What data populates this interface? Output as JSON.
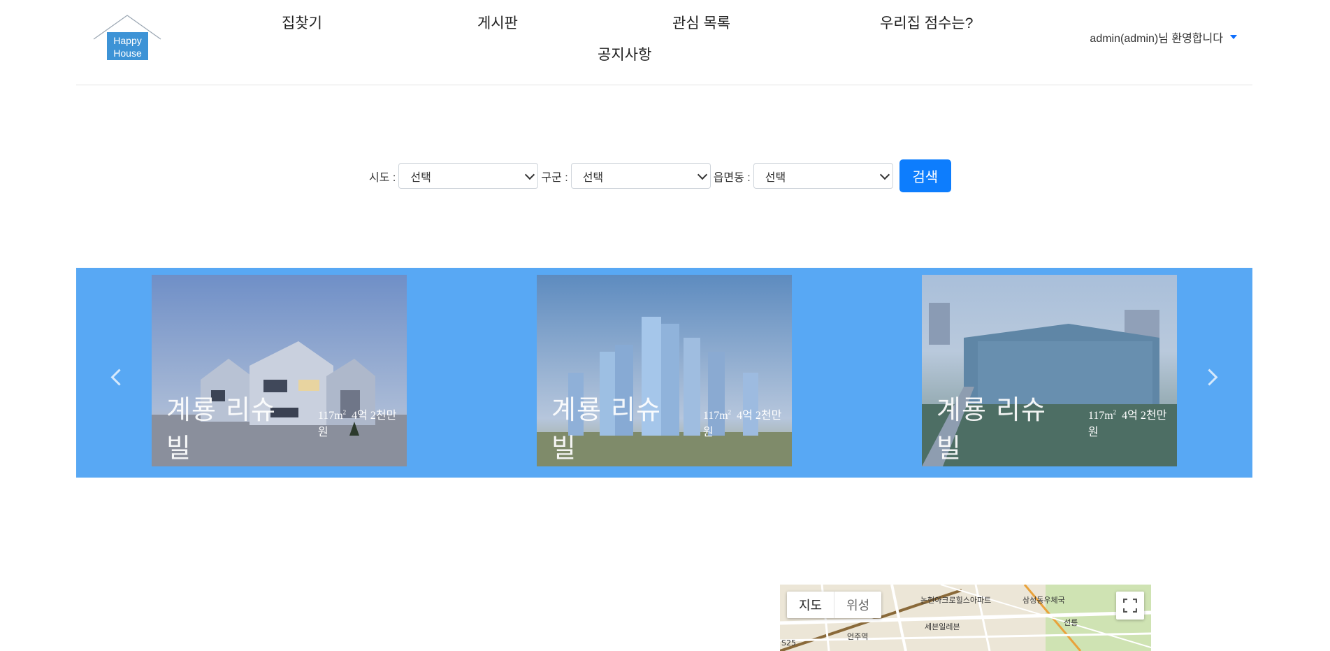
{
  "header": {
    "logo_line1": "Happy",
    "logo_line2": "House",
    "nav": [
      "집찾기",
      "게시판",
      "관심 목록",
      "우리집 점수는?",
      "공지사항"
    ],
    "user_greeting": "admin(admin)님 환영합니다"
  },
  "search": {
    "sido_label": "시도 :",
    "gugun_label": "구군 :",
    "dong_label": "읍면동 :",
    "sido_value": "선택",
    "gugun_value": "선택",
    "dong_value": "선택",
    "button": "검색"
  },
  "carousel": {
    "slides": [
      {
        "title": "계룡 리슈빌",
        "area": "117m",
        "sup": "2",
        "price": "4억 2천만원"
      },
      {
        "title": "계룡 리슈빌",
        "area": "117m",
        "sup": "2",
        "price": "4억 2천만원"
      },
      {
        "title": "계룡 리슈빌",
        "area": "117m",
        "sup": "2",
        "price": "4억 2천만원"
      }
    ]
  },
  "map": {
    "type_map": "지도",
    "type_satellite": "위성",
    "labels": [
      "논현아크로힐스아파트",
      "삼성동우체국",
      "세븐일레븐",
      "언주역",
      "선릉",
      "S25"
    ]
  },
  "colors": {
    "accent": "#0d7dfd",
    "carousel_bg": "#58a8f4",
    "logo_blue": "#3d93d6"
  }
}
